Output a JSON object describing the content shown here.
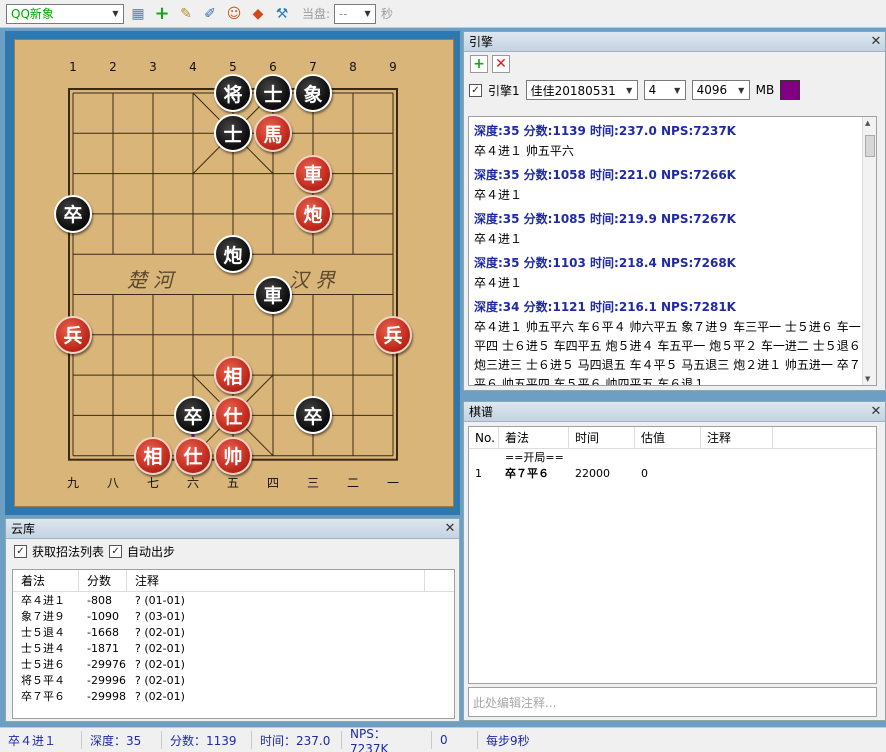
{
  "toolbar": {
    "engine_select": "QQ新象",
    "current_label": "当盘:",
    "current_value": "--",
    "seconds_label": "秒"
  },
  "board": {
    "top_files": [
      "1",
      "2",
      "3",
      "4",
      "5",
      "6",
      "7",
      "8",
      "9"
    ],
    "bottom_files": [
      "九",
      "八",
      "七",
      "六",
      "五",
      "四",
      "三",
      "二",
      "一"
    ],
    "river_left": "楚河",
    "river_right": "汉界",
    "pieces": [
      {
        "char": "将",
        "color": "black",
        "file": 4,
        "rank": 0
      },
      {
        "char": "士",
        "color": "black",
        "file": 5,
        "rank": 0
      },
      {
        "char": "象",
        "color": "black",
        "file": 6,
        "rank": 0
      },
      {
        "char": "士",
        "color": "black",
        "file": 4,
        "rank": 1
      },
      {
        "char": "馬",
        "color": "red",
        "file": 5,
        "rank": 1
      },
      {
        "char": "車",
        "color": "red",
        "file": 6,
        "rank": 2
      },
      {
        "char": "卒",
        "color": "black",
        "file": 0,
        "rank": 3
      },
      {
        "char": "炮",
        "color": "red",
        "file": 6,
        "rank": 3
      },
      {
        "char": "炮",
        "color": "black",
        "file": 4,
        "rank": 4
      },
      {
        "char": "車",
        "color": "black",
        "file": 5,
        "rank": 5
      },
      {
        "char": "兵",
        "color": "red",
        "file": 0,
        "rank": 6
      },
      {
        "char": "兵",
        "color": "red",
        "file": 8,
        "rank": 6
      },
      {
        "char": "相",
        "color": "red",
        "file": 4,
        "rank": 7
      },
      {
        "char": "卒",
        "color": "black",
        "file": 3,
        "rank": 8
      },
      {
        "char": "仕",
        "color": "red",
        "file": 4,
        "rank": 8
      },
      {
        "char": "卒",
        "color": "black",
        "file": 6,
        "rank": 8
      },
      {
        "char": "相",
        "color": "red",
        "file": 2,
        "rank": 9
      },
      {
        "char": "仕",
        "color": "red",
        "file": 3,
        "rank": 9
      },
      {
        "char": "帅",
        "color": "red",
        "file": 4,
        "rank": 9
      }
    ]
  },
  "engine": {
    "title": "引擎",
    "engine_label": "引擎1",
    "engine_name": "佳佳20180531",
    "threads": "4",
    "hash": "4096",
    "hash_unit": "MB",
    "lines": [
      {
        "head": "深度:35  分数:1139  时间:237.0  NPS:7237K",
        "pv": "卒４进１ 帅五平六"
      },
      {
        "head": "深度:35  分数:1058  时间:221.0  NPS:7266K",
        "pv": "卒４进１"
      },
      {
        "head": "深度:35  分数:1085  时间:219.9  NPS:7267K",
        "pv": "卒４进１"
      },
      {
        "head": "深度:35  分数:1103  时间:218.4  NPS:7268K",
        "pv": "卒４进１"
      },
      {
        "head": "深度:34  分数:1121  时间:216.1  NPS:7281K",
        "pv": "卒４进１ 帅五平六 车６平４ 帅六平五 象７进９ 车三平一 士５进６ 车一平四 士６进５ 车四平五 炮５进４ 车五平一 炮５平２ 车一进二 士５退６ 炮三进三 士６进５ 马四退五 车４平５ 马五退三 炮２进１ 帅五进一 卒７平６ 帅五平四 车５平６ 帅四平五 车６退１"
      }
    ]
  },
  "record": {
    "title": "棋谱",
    "columns": [
      "No.",
      "着法",
      "时间",
      "估值",
      "注释"
    ],
    "opening": "==开局==",
    "rows": [
      {
        "no": "1",
        "move": "卒７平６",
        "time": "22000",
        "eval": "0",
        "note": ""
      }
    ],
    "note_placeholder": "此处编辑注释..."
  },
  "cloud": {
    "title": "云库",
    "opt_list": "获取招法列表",
    "opt_auto": "自动出步",
    "columns": [
      "着法",
      "分数",
      "注释"
    ],
    "rows": [
      {
        "move": "卒４进１",
        "score": "-808",
        "note": "?  (01-01)"
      },
      {
        "move": "象７进９",
        "score": "-1090",
        "note": "?  (03-01)"
      },
      {
        "move": "士５退４",
        "score": "-1668",
        "note": "?  (02-01)"
      },
      {
        "move": "士５进４",
        "score": "-1871",
        "note": "?  (02-01)"
      },
      {
        "move": "士５进６",
        "score": "-29976",
        "note": "?  (02-01)"
      },
      {
        "move": "将５平４",
        "score": "-29996",
        "note": "?  (02-01)"
      },
      {
        "move": "卒７平６",
        "score": "-29998",
        "note": "?  (02-01)"
      }
    ]
  },
  "status": {
    "move": "卒４进１",
    "depth": "深度：35",
    "score": "分数：1139",
    "time": "时间：237.0",
    "nps": "NPS：7237K",
    "count": "0",
    "per_move": "每步9秒"
  },
  "colors": {
    "accent": "#1f2aa8",
    "piece_red": "#c22c1f",
    "piece_black": "#111111",
    "board": "#d9b57a"
  }
}
